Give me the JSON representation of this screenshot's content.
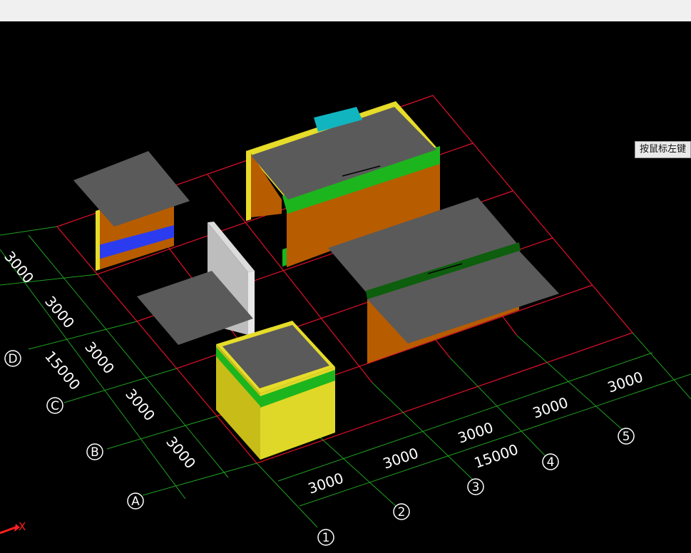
{
  "tooltip": {
    "text": "按鼠标左键"
  },
  "axes": {
    "rows": [
      "A",
      "B",
      "C",
      "D"
    ],
    "columns": [
      "1",
      "2",
      "3",
      "4",
      "5"
    ]
  },
  "dimensions": {
    "row_spacing": [
      "3000",
      "3000",
      "3000",
      "3000",
      "3000"
    ],
    "row_total": "15000",
    "column_spacing": [
      "3000",
      "3000",
      "3000",
      "3000",
      "3000"
    ],
    "column_total": "15000"
  },
  "coordinate_indicator": {
    "x_label": "X"
  },
  "colors": {
    "background": "#000000",
    "grid_red": "#e0102a",
    "grid_green": "#20a020",
    "slab": "#5a5a5a",
    "wall_orange": "#b85c00",
    "wall_yellow": "#e6dc2a",
    "beam_green": "#20b020",
    "beam_blue": "#2b3cf0",
    "beam_cyan": "#10b5c0",
    "partition_gray": "#c0c0c0"
  }
}
